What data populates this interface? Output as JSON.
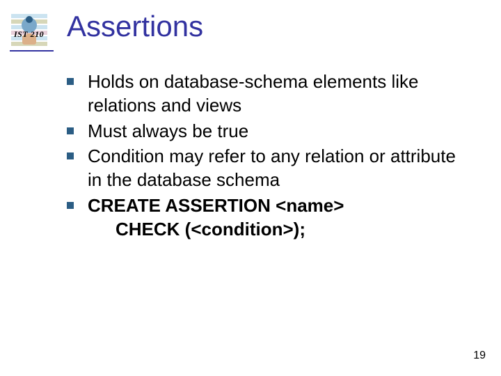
{
  "course_label": "IST 210",
  "title": "Assertions",
  "bullets": [
    {
      "html": "Holds on database-schema elements like relations and views"
    },
    {
      "html": "Must always be true"
    },
    {
      "html": "Condition may refer to any relation or attribute in the database schema"
    },
    {
      "html": "<span class=\"bold\">CREATE ASSERTION &lt;name&gt;</span><span class=\"indent bold\">CHECK (&lt;condition&gt;);</span>"
    }
  ],
  "page_number": "19"
}
